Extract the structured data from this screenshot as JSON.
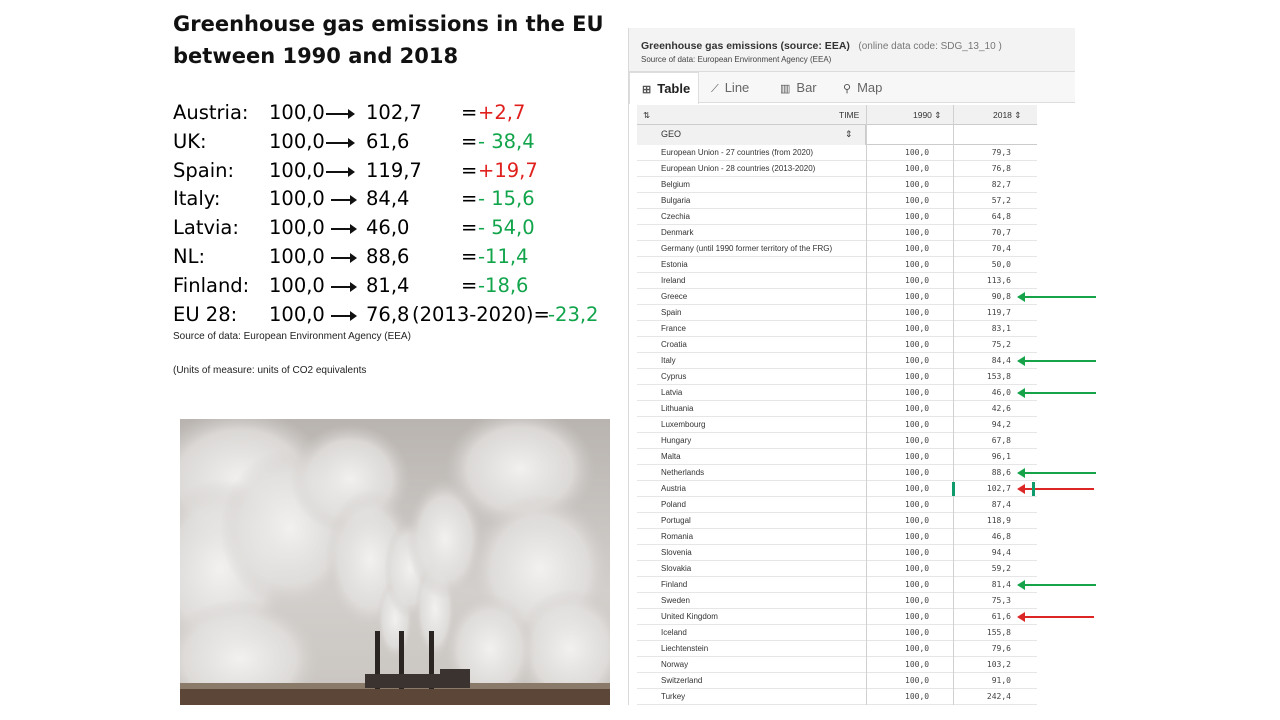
{
  "slide": {
    "title_line1": "Greenhouse gas emissions in the EU",
    "title_line2": "between 1990 and 2018",
    "comparisons": [
      {
        "country": "Austria:",
        "base": "100,0",
        "value": "102,7",
        "eq": "=",
        "diff": "+2,7",
        "direction": "up",
        "extra": ""
      },
      {
        "country": "UK:",
        "base": "100,0",
        "value": "61,6",
        "eq": "=",
        "diff": "- 38,4",
        "direction": "down",
        "extra": ""
      },
      {
        "country": "Spain:",
        "base": "100,0",
        "value": "119,7",
        "eq": "=",
        "diff": "+19,7",
        "direction": "up",
        "extra": ""
      },
      {
        "country": "Italy:",
        "base": "100,0",
        "value": "84,4",
        "eq": "=",
        "diff": "- 15,6",
        "direction": "down",
        "extra": ""
      },
      {
        "country": "Latvia:",
        "base": "100,0",
        "value": "46,0",
        "eq": "=",
        "diff": "- 54,0",
        "direction": "down",
        "extra": ""
      },
      {
        "country": "NL:",
        "base": "100,0",
        "value": "88,6",
        "eq": "=",
        "diff": "-11,4",
        "direction": "down",
        "extra": ""
      },
      {
        "country": "Finland:",
        "base": "100,0",
        "value": "81,4",
        "eq": "=",
        "diff": "-18,6",
        "direction": "down",
        "extra": ""
      },
      {
        "country": "EU 28:",
        "base": "100,0",
        "value": "76,8",
        "eq": "",
        "diff": "-23,2",
        "direction": "down",
        "extra": "(2013-2020)="
      }
    ],
    "source_note": "Source of data: European Environment Agency (EEA)",
    "units_note": "(Units of measure: units of CO2 equivalents"
  },
  "eurostat": {
    "title": "Greenhouse gas emissions (source: EEA)",
    "code": "(online data code: SDG_13_10 )",
    "source": "Source of data: European Environment Agency (EEA)",
    "tabs": [
      {
        "label": "Table",
        "icon": "table-icon",
        "glyph": "⊞",
        "active": true
      },
      {
        "label": "Line",
        "icon": "line-chart-icon",
        "glyph": "⟋",
        "active": false
      },
      {
        "label": "Bar",
        "icon": "bar-chart-icon",
        "glyph": "▥",
        "active": false
      },
      {
        "label": "Map",
        "icon": "map-pin-icon",
        "glyph": "⚲",
        "active": false
      }
    ],
    "header": {
      "sort": "⇅",
      "time": "TIME",
      "y1": "1990 ⇕",
      "y2": "2018 ⇕",
      "geo": "GEO",
      "geo_sort": "⇕"
    },
    "rows": [
      {
        "geo": "European Union - 27 countries (from 2020)",
        "v1990": "100,0",
        "v2018": "79,3"
      },
      {
        "geo": "European Union - 28 countries (2013-2020)",
        "v1990": "100,0",
        "v2018": "76,8"
      },
      {
        "geo": "Belgium",
        "v1990": "100,0",
        "v2018": "82,7"
      },
      {
        "geo": "Bulgaria",
        "v1990": "100,0",
        "v2018": "57,2"
      },
      {
        "geo": "Czechia",
        "v1990": "100,0",
        "v2018": "64,8"
      },
      {
        "geo": "Denmark",
        "v1990": "100,0",
        "v2018": "70,7"
      },
      {
        "geo": "Germany (until 1990 former territory of the FRG)",
        "v1990": "100,0",
        "v2018": "70,4"
      },
      {
        "geo": "Estonia",
        "v1990": "100,0",
        "v2018": "50,0"
      },
      {
        "geo": "Ireland",
        "v1990": "100,0",
        "v2018": "113,6"
      },
      {
        "geo": "Greece",
        "v1990": "100,0",
        "v2018": "90,8",
        "marker": "green"
      },
      {
        "geo": "Spain",
        "v1990": "100,0",
        "v2018": "119,7"
      },
      {
        "geo": "France",
        "v1990": "100,0",
        "v2018": "83,1"
      },
      {
        "geo": "Croatia",
        "v1990": "100,0",
        "v2018": "75,2"
      },
      {
        "geo": "Italy",
        "v1990": "100,0",
        "v2018": "84,4",
        "marker": "green"
      },
      {
        "geo": "Cyprus",
        "v1990": "100,0",
        "v2018": "153,8"
      },
      {
        "geo": "Latvia",
        "v1990": "100,0",
        "v2018": "46,0",
        "marker": "green"
      },
      {
        "geo": "Lithuania",
        "v1990": "100,0",
        "v2018": "42,6"
      },
      {
        "geo": "Luxembourg",
        "v1990": "100,0",
        "v2018": "94,2"
      },
      {
        "geo": "Hungary",
        "v1990": "100,0",
        "v2018": "67,8"
      },
      {
        "geo": "Malta",
        "v1990": "100,0",
        "v2018": "96,1"
      },
      {
        "geo": "Netherlands",
        "v1990": "100,0",
        "v2018": "88,6",
        "marker": "green"
      },
      {
        "geo": "Austria",
        "v1990": "100,0",
        "v2018": "102,7",
        "marker": "red"
      },
      {
        "geo": "Poland",
        "v1990": "100,0",
        "v2018": "87,4"
      },
      {
        "geo": "Portugal",
        "v1990": "100,0",
        "v2018": "118,9"
      },
      {
        "geo": "Romania",
        "v1990": "100,0",
        "v2018": "46,8"
      },
      {
        "geo": "Slovenia",
        "v1990": "100,0",
        "v2018": "94,4"
      },
      {
        "geo": "Slovakia",
        "v1990": "100,0",
        "v2018": "59,2"
      },
      {
        "geo": "Finland",
        "v1990": "100,0",
        "v2018": "81,4",
        "marker": "green"
      },
      {
        "geo": "Sweden",
        "v1990": "100,0",
        "v2018": "75,3"
      },
      {
        "geo": "United Kingdom",
        "v1990": "100,0",
        "v2018": "61,6",
        "marker": "red"
      },
      {
        "geo": "Iceland",
        "v1990": "100,0",
        "v2018": "155,8"
      },
      {
        "geo": "Liechtenstein",
        "v1990": "100,0",
        "v2018": "79,6"
      },
      {
        "geo": "Norway",
        "v1990": "100,0",
        "v2018": "103,2"
      },
      {
        "geo": "Switzerland",
        "v1990": "100,0",
        "v2018": "91,0"
      },
      {
        "geo": "Turkey",
        "v1990": "100,0",
        "v2018": "242,4"
      }
    ]
  },
  "colors": {
    "increase": "#e0201c",
    "decrease": "#11a44b",
    "green_marker": "#16a34a",
    "red_marker": "#dc2626"
  }
}
